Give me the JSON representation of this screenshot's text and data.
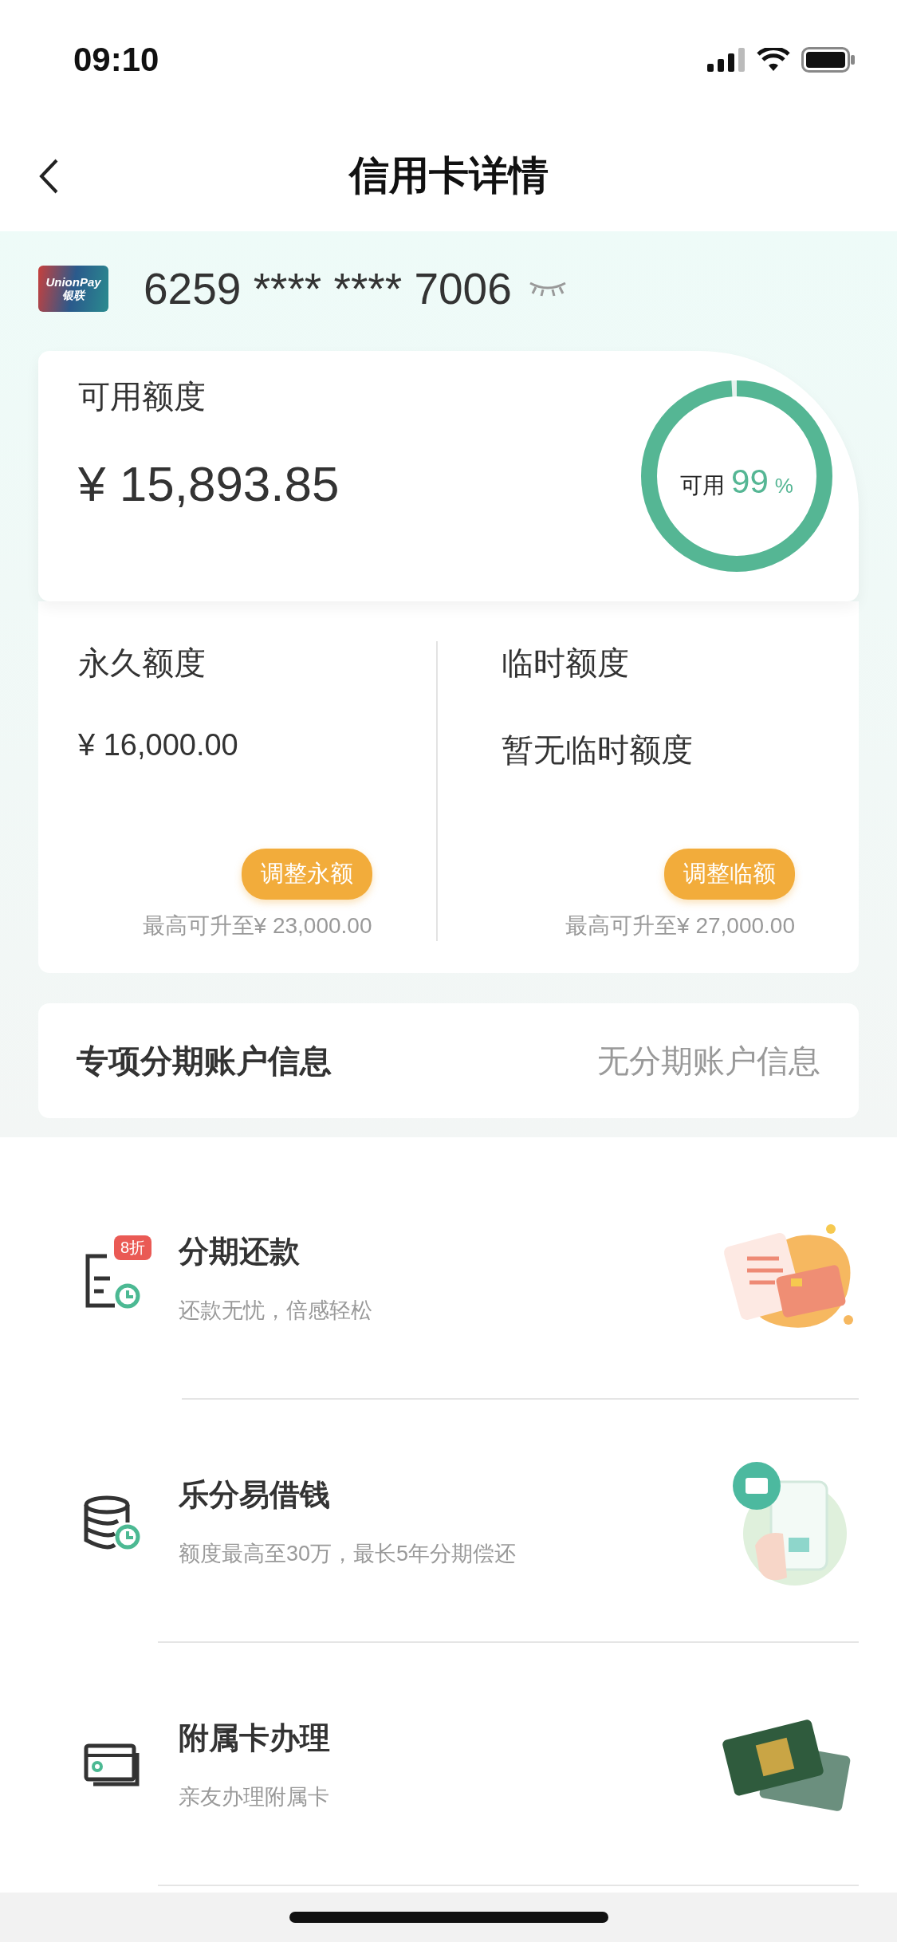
{
  "status_bar": {
    "time": "09:10"
  },
  "nav": {
    "title": "信用卡详情"
  },
  "card": {
    "number": "6259 **** **** 7006",
    "logo_top": "UnionPay",
    "logo_bottom": "银联"
  },
  "available": {
    "label": "可用额度",
    "amount": "¥ 15,893.85",
    "ring_label": "可用",
    "ring_value": "99",
    "ring_unit": "%",
    "level": 0.99
  },
  "limits": [
    {
      "label": "永久额度",
      "value": "¥ 16,000.00",
      "button": "调整永额",
      "note": "最高可升至¥ 23,000.00"
    },
    {
      "label": "临时额度",
      "value": "暂无临时额度",
      "button": "调整临额",
      "note": "最高可升至¥ 27,000.00"
    }
  ],
  "installment_account": {
    "label": "专项分期账户信息",
    "value": "无分期账户信息"
  },
  "services": [
    {
      "kind": "bill",
      "title": "分期还款",
      "subtitle": "还款无忧，倍感轻松",
      "badge": "8折"
    },
    {
      "kind": "loan",
      "title": "乐分易借钱",
      "subtitle": "额度最高至30万，最长5年分期偿还"
    },
    {
      "kind": "card",
      "title": "附属卡办理",
      "subtitle": "亲友办理附属卡"
    }
  ]
}
